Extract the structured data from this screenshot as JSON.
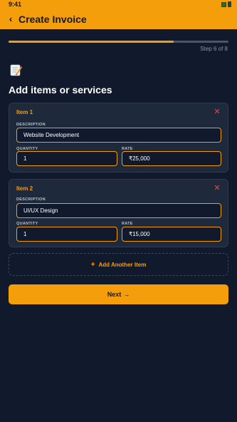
{
  "status_bar": {
    "time": "9:41",
    "signal_icon": "signal-icon",
    "battery_icon": "battery-icon"
  },
  "header": {
    "back_icon": "chevron-left-icon",
    "back_glyph": "‹",
    "title": "Create Invoice"
  },
  "progress": {
    "step_text": "Step 6 of 8",
    "fraction": 0.75
  },
  "page": {
    "icon": "memo-icon",
    "title": "Add items or services"
  },
  "items": [
    {
      "heading": "Item 1",
      "remove_glyph": "✕",
      "description_label": "DESCRIPTION",
      "description_value": "Website Development",
      "quantity_label": "QUANTITY",
      "quantity_value": "1",
      "rate_label": "RATE",
      "rate_value": "₹25,000"
    },
    {
      "heading": "Item 2",
      "remove_glyph": "✕",
      "description_label": "DESCRIPTION",
      "description_value": "UI/UX Design",
      "quantity_label": "QUANTITY",
      "quantity_value": "1",
      "rate_label": "RATE",
      "rate_value": "₹15,000"
    }
  ],
  "add_item": {
    "icon": "plus-icon",
    "glyph": "+",
    "label": "Add Another Item"
  },
  "next_button": {
    "label": "Next",
    "icon": "arrow-right-icon",
    "glyph": "→"
  },
  "colors": {
    "accent": "#f59e0b",
    "background": "#111a2c",
    "card": "#1e293b",
    "danger": "#ef4444"
  }
}
